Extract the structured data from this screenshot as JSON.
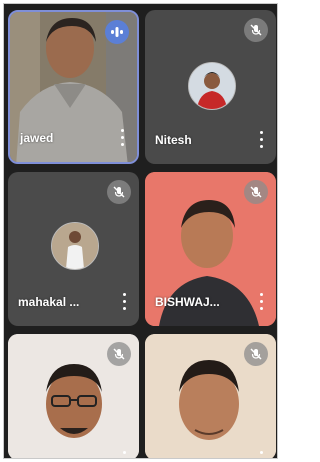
{
  "participants": [
    {
      "name": "jawed",
      "state": "speaking"
    },
    {
      "name": "Nitesh",
      "state": "muted"
    },
    {
      "name": "mahakal ...",
      "state": "muted"
    },
    {
      "name": "BISHWAJ...",
      "state": "muted"
    },
    {
      "name": "",
      "state": "muted"
    },
    {
      "name": "",
      "state": "muted"
    }
  ],
  "icons": {
    "mute": "mic-off-icon",
    "speaking": "audio-level-icon",
    "more": "more-vert-icon"
  },
  "colors": {
    "tile_dark": "#4a4a4a",
    "active_border": "#7f8fd8",
    "speaking_indicator": "#5b7fd6"
  }
}
